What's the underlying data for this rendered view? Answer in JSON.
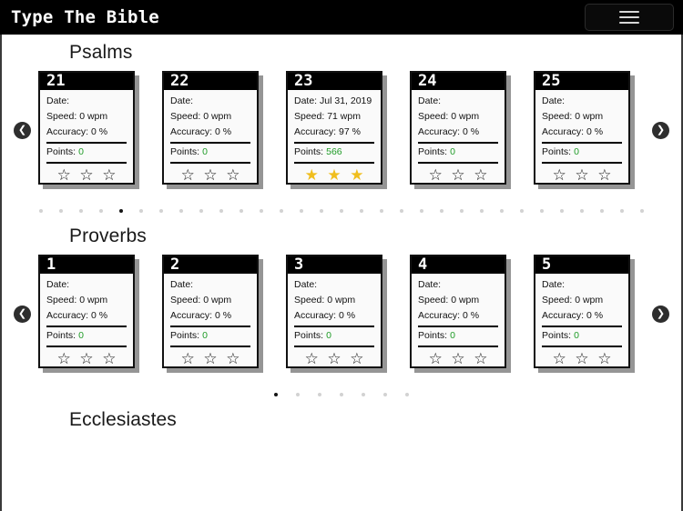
{
  "navbar": {
    "brand": "Type The Bible",
    "menu_icon": "hamburger-icon",
    "menu_label": "Menu"
  },
  "labels": {
    "date": "Date:",
    "speed": "Speed:",
    "accuracy": "Accuracy:",
    "points": "Points:",
    "arrow_left": "❮",
    "arrow_right": "❯",
    "star_empty": "☆",
    "star_full": "★"
  },
  "colors": {
    "navbar_bg": "#000000",
    "card_header_bg": "#000000",
    "card_bg": "#fafafa",
    "points_green": "#1f9b27",
    "star_gold": "#F0BE1E",
    "star_empty": "#1a1a1a",
    "page_bg": "#ffffff",
    "dot_active": "#141414",
    "dot_inactive": "#d2d2d2"
  },
  "sections": [
    {
      "title": "Psalms",
      "cards": [
        {
          "number": "21",
          "date": "",
          "speed": "0 wpm",
          "accuracy": "0 %",
          "points": "0",
          "stars": 0
        },
        {
          "number": "22",
          "date": "",
          "speed": "0 wpm",
          "accuracy": "0 %",
          "points": "0",
          "stars": 0
        },
        {
          "number": "23",
          "date": "Jul 31, 2019",
          "speed": "71 wpm",
          "accuracy": "97 %",
          "points": "566",
          "stars": 3
        },
        {
          "number": "24",
          "date": "",
          "speed": "0 wpm",
          "accuracy": "0 %",
          "points": "0",
          "stars": 0
        },
        {
          "number": "25",
          "date": "",
          "speed": "0 wpm",
          "accuracy": "0 %",
          "points": "0",
          "stars": 0
        }
      ],
      "dots_total": 31,
      "dots_active_index": 4
    },
    {
      "title": "Proverbs",
      "cards": [
        {
          "number": "1",
          "date": "",
          "speed": "0 wpm",
          "accuracy": "0 %",
          "points": "0",
          "stars": 0
        },
        {
          "number": "2",
          "date": "",
          "speed": "0 wpm",
          "accuracy": "0 %",
          "points": "0",
          "stars": 0
        },
        {
          "number": "3",
          "date": "",
          "speed": "0 wpm",
          "accuracy": "0 %",
          "points": "0",
          "stars": 0
        },
        {
          "number": "4",
          "date": "",
          "speed": "0 wpm",
          "accuracy": "0 %",
          "points": "0",
          "stars": 0
        },
        {
          "number": "5",
          "date": "",
          "speed": "0 wpm",
          "accuracy": "0 %",
          "points": "0",
          "stars": 0
        }
      ],
      "dots_total": 7,
      "dots_active_index": 0
    },
    {
      "title": "Ecclesiastes",
      "cards": [],
      "dots_total": 0,
      "dots_active_index": 0
    }
  ]
}
